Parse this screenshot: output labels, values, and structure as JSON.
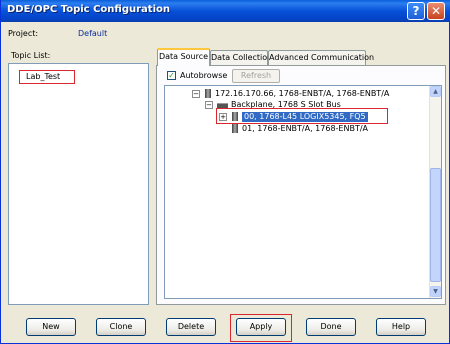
{
  "window": {
    "title": "DDE/OPC Topic Configuration",
    "help_button": "?",
    "close_button": "✕"
  },
  "project": {
    "label": "Project:",
    "value": "Default"
  },
  "topic_list": {
    "label": "Topic List:",
    "items": [
      "Lab_Test"
    ]
  },
  "tabs": [
    {
      "label": "Data Source",
      "active": true
    },
    {
      "label": "Data Collection",
      "active": false
    },
    {
      "label": "Advanced Communication",
      "active": false
    }
  ],
  "data_source": {
    "autobrowse_label": "Autobrowse",
    "autobrowse_checked": true,
    "refresh_label": "Refresh",
    "tree": [
      {
        "expander": "−",
        "icon": "device-icon",
        "label": "172.16.170.66, 1768-ENBT/A, 1768-ENBT/A"
      },
      {
        "expander": "−",
        "icon": "backplane-icon",
        "label": "Backplane, 1768 S Slot Bus"
      },
      {
        "expander": "+",
        "icon": "device-icon",
        "label": "00, 1768-L45 LOGIX5345, FQ5",
        "selected": true
      },
      {
        "expander": "",
        "icon": "device-icon",
        "label": "01, 1768-ENBT/A, 1768-ENBT/A"
      }
    ]
  },
  "buttons": {
    "new": "New",
    "clone": "Clone",
    "delete": "Delete",
    "apply": "Apply",
    "done": "Done",
    "help": "Help"
  },
  "colors": {
    "title_bar": "#0751D8",
    "highlight_box": "#D9272D",
    "selection": "#316AC5"
  }
}
